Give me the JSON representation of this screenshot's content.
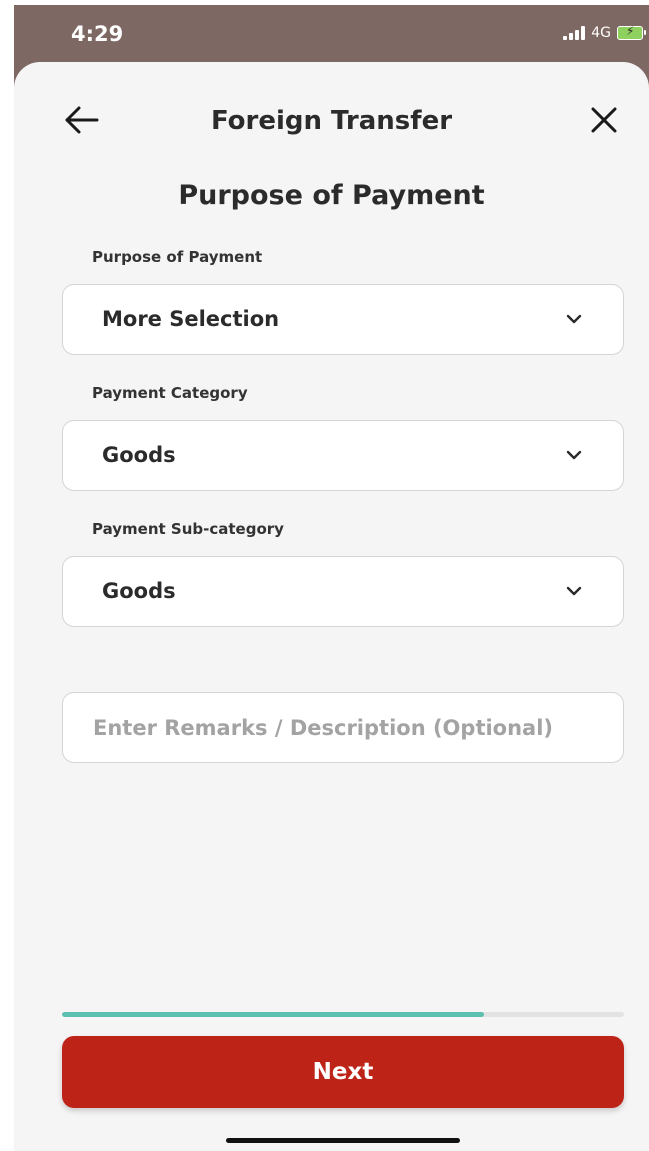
{
  "status_bar": {
    "time": "4:29",
    "network": "4G",
    "icons": [
      "signal-icon",
      "battery-charging-icon"
    ]
  },
  "header": {
    "title": "Foreign Transfer",
    "back_icon": "arrow-left-icon",
    "close_icon": "close-icon"
  },
  "section_title": "Purpose of Payment",
  "fields": [
    {
      "label": "Purpose of Payment",
      "value": "More Selection",
      "icon": "chevron-down-icon"
    },
    {
      "label": "Payment Category",
      "value": "Goods",
      "icon": "chevron-down-icon"
    },
    {
      "label": "Payment Sub-category",
      "value": "Goods",
      "icon": "chevron-down-icon"
    }
  ],
  "remarks": {
    "placeholder": "Enter Remarks / Description (Optional)",
    "value": ""
  },
  "progress": {
    "fraction": 0.75
  },
  "next_button": {
    "label": "Next"
  },
  "colors": {
    "primary": "#be2318",
    "progress": "#5cbfb0",
    "background": "#f5f5f5",
    "status_bar": "#7d6863"
  }
}
